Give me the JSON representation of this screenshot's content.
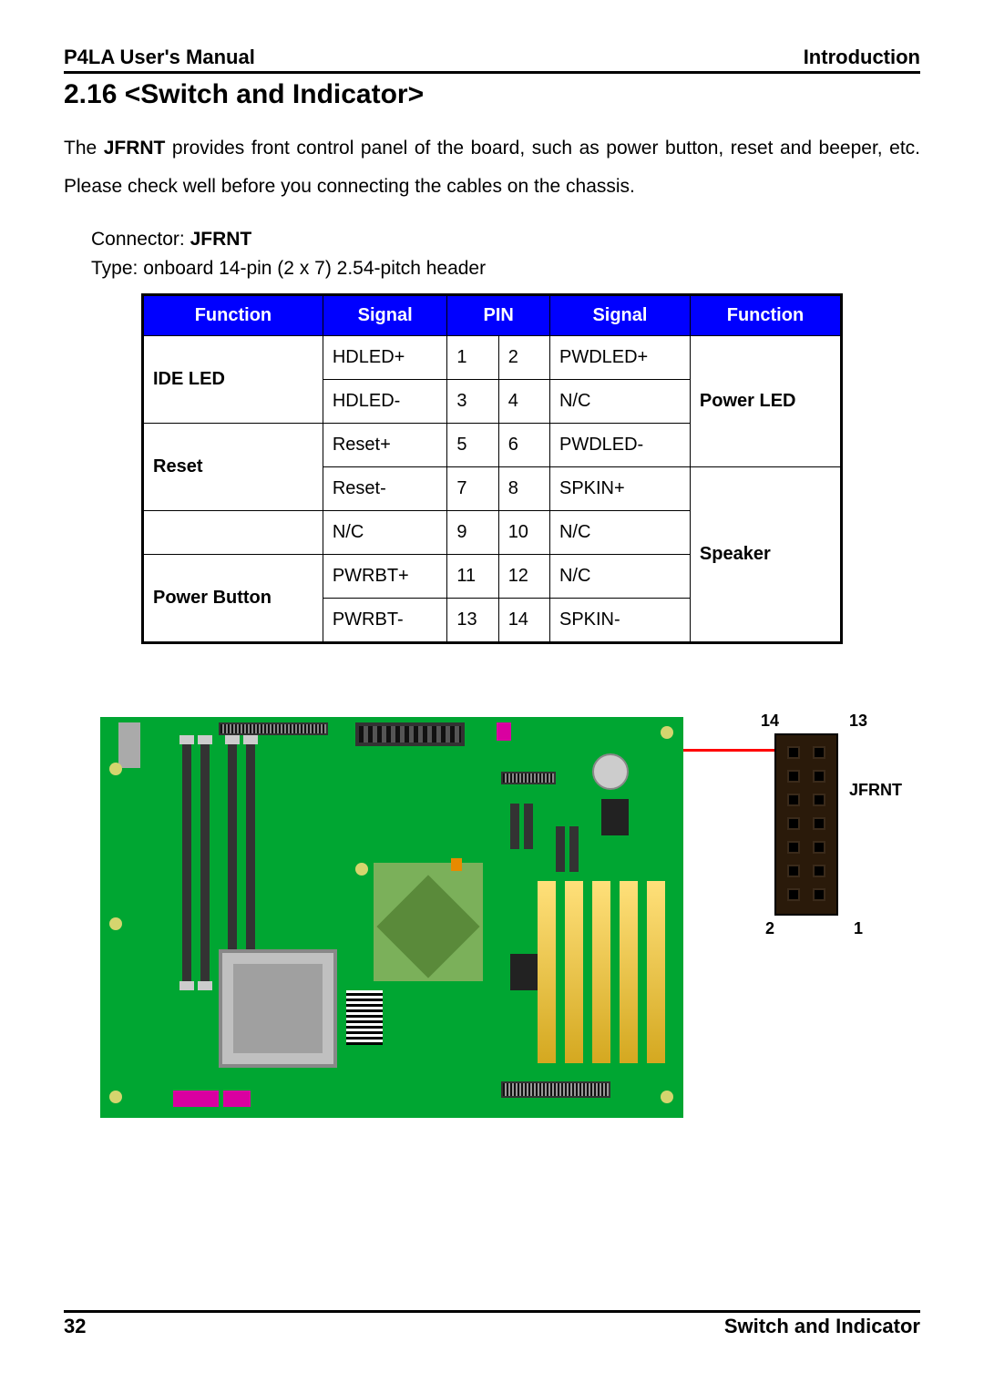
{
  "header": {
    "left": "P4LA User's Manual",
    "right": "Introduction"
  },
  "section_title": "2.16 <Switch and Indicator>",
  "desc_parts": {
    "p1a": "The ",
    "p1b": "JFRNT",
    "p1c": " provides front control panel of the board, such as power button, reset and beeper, etc. Please check well before you connecting the cables on the chassis."
  },
  "connector": {
    "label": "Connector: ",
    "name": "JFRNT",
    "type": "Type: onboard 14-pin (2 x 7) 2.54-pitch header"
  },
  "table_headers": {
    "func_l": "Function",
    "sig_l": "Signal",
    "pin": "PIN",
    "sig_r": "Signal",
    "func_r": "Function"
  },
  "rows": [
    {
      "f_l": "IDE LED",
      "sig_l": "HDLED+",
      "pin_l": "1",
      "pin_r": "2",
      "sig_r": "PWDLED+",
      "f_r": "Power LED"
    },
    {
      "f_l": "",
      "sig_l": "HDLED-",
      "pin_l": "3",
      "pin_r": "4",
      "sig_r": "N/C",
      "f_r": ""
    },
    {
      "f_l": "Reset",
      "sig_l": "Reset+",
      "pin_l": "5",
      "pin_r": "6",
      "sig_r": "PWDLED-",
      "f_r": ""
    },
    {
      "f_l": "",
      "sig_l": "Reset-",
      "pin_l": "7",
      "pin_r": "8",
      "sig_r": "SPKIN+",
      "f_r": "Speaker"
    },
    {
      "f_l": "",
      "sig_l": "N/C",
      "pin_l": "9",
      "pin_r": "10",
      "sig_r": "N/C",
      "f_r": ""
    },
    {
      "f_l": "Power Button",
      "sig_l": "PWRBT+",
      "pin_l": "11",
      "pin_r": "12",
      "sig_r": "N/C",
      "f_r": ""
    },
    {
      "f_l": "",
      "sig_l": "PWRBT-",
      "pin_l": "13",
      "pin_r": "14",
      "sig_r": "SPKIN-",
      "f_r": ""
    }
  ],
  "callout": {
    "label_top_l": "14",
    "label_top_r": "13",
    "label_name": "JFRNT",
    "label_bot_l": "2",
    "label_bot_r": "1"
  },
  "footer": {
    "page": "32",
    "title": "Switch and Indicator"
  }
}
